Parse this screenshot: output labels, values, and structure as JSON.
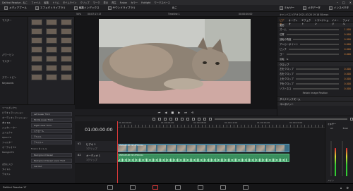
{
  "titlebar": {
    "app": "DaVinci Resolve - ねこ",
    "menus": [
      "DaVinci Resolve",
      "ファイル",
      "編集",
      "トリム",
      "タイムライン",
      "クリップ",
      "マーク",
      "表示",
      "再生",
      "Fusion",
      "カラー",
      "Fairlight",
      "ワークスペース",
      "ヘルプ"
    ]
  },
  "toolbar": {
    "left": [
      "メディアプール",
      "エフェクトライブラリ",
      "編集インデックス",
      "サウンドライブラリ"
    ],
    "center": "ねこ",
    "right": [
      "ミキサー",
      "メタデータ",
      "インスペクタ"
    ]
  },
  "subbar": {
    "zoom": "50%",
    "src_tc": "00:07:17:17",
    "timeline_name": "Timeline 1",
    "tc": "00:00:00:00",
    "clip_info": "キャンバス ビデオ 2021-03-20 19 18 58.mov"
  },
  "leftpanel": {
    "master": "マスター",
    "power_bins": "パワービン",
    "smart_bins": "スマートビン",
    "keywords": "Keywords"
  },
  "effects": {
    "title": "ツールボックス",
    "items": [
      "ビデオトランジション",
      "オーディオトランジション",
      "タイトル",
      "ジェネレーター",
      "エフェクト",
      "Open FX",
      "フィルター",
      "オーディオ FX",
      "Fairlight FX"
    ],
    "favorites": "お気に入り",
    "fav_items": [
      "タイトル",
      "テキスト"
    ],
    "titles": [
      "Left Lower Third",
      "Middle Lower Third",
      "Right Lower Third",
      "スクロール",
      "テキスト",
      "テキスト+",
      "Background Reveal",
      "Background Reveal Lower Third",
      "Call Out"
    ],
    "fusion": "Fusion タイトル"
  },
  "inspector": {
    "video_tab": "ビデオ",
    "audio_tab": "オーディオ",
    "effect_tab": "エフェクト",
    "transition_tab": "トランジション",
    "image_tab": "イメージ",
    "file_tab": "ファイル",
    "transform": "変形",
    "crop": "クロップ",
    "dynamic_zoom": "ダイナミックズーム",
    "composite": "コンポジット",
    "rows": [
      {
        "label": "ズーム",
        "value": "1.000"
      },
      {
        "label": "位置",
        "value": "0.000"
      },
      {
        "label": "回転の角度",
        "value": "0.000"
      },
      {
        "label": "アンカーポイント",
        "value": "0.000"
      },
      {
        "label": "ピッチ",
        "value": "0.000"
      },
      {
        "label": "ヨー",
        "value": "0.000"
      },
      {
        "label": "反転",
        "value": ""
      }
    ],
    "crop_rows": [
      {
        "label": "左をクロップ",
        "value": "0.000"
      },
      {
        "label": "右をクロップ",
        "value": "0.000"
      },
      {
        "label": "上をクロップ",
        "value": "0.000"
      },
      {
        "label": "下をクロップ",
        "value": "0.000"
      },
      {
        "label": "ソフトネス",
        "value": "0.000"
      }
    ],
    "retain": "Retain Image Position"
  },
  "timeline": {
    "timecode": "01:00:00:00",
    "ruler": [
      "01:00:00:00",
      "01:00:04:00",
      "01:00:08:00",
      "01:00:12:00",
      "01:00:16:00",
      "01:00:20:00",
      "01:00:24:00"
    ],
    "v1": "ビデオ 1",
    "v1_sub": "1クリップ",
    "a1": "オーディオ 1",
    "a1_sub": "1クリップ",
    "vclip_label": "2021-03-20 19 18 58.mov",
    "aclip_label": "2021-03-20 19 18 58.mov"
  },
  "mixer": {
    "title": "ミキサー",
    "a1": "A1",
    "bus": "Bus1",
    "main": "メイン"
  },
  "bottombar": {
    "app": "DaVinci Resolve 17"
  },
  "colors": {
    "accent": "#e08a3c",
    "video_clip": "#3d6f86",
    "audio_clip": "#3a8f5e",
    "playhead": "#e03a3a"
  }
}
